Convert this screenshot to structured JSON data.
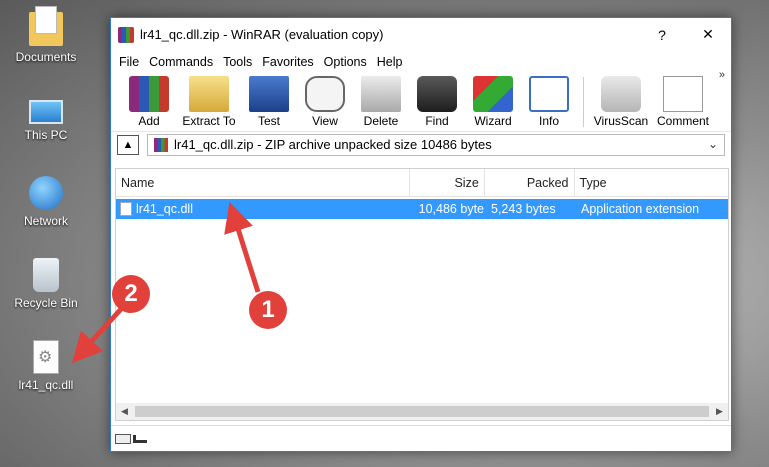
{
  "desktop": {
    "icons": [
      {
        "label": "Documents"
      },
      {
        "label": "This PC"
      },
      {
        "label": "Network"
      },
      {
        "label": "Recycle Bin"
      },
      {
        "label": "lr41_qc.dll"
      }
    ]
  },
  "window": {
    "title": "lr41_qc.dll.zip - WinRAR (evaluation copy)",
    "help_btn": "?",
    "close_btn": "✕",
    "menu": [
      "File",
      "Commands",
      "Tools",
      "Favorites",
      "Options",
      "Help"
    ],
    "toolbar": [
      "Add",
      "Extract To",
      "Test",
      "View",
      "Delete",
      "Find",
      "Wizard",
      "Info",
      "VirusScan",
      "Comment"
    ],
    "toolbar_more": "»",
    "address": "lr41_qc.dll.zip - ZIP archive unpacked size 10486 bytes",
    "columns": {
      "name": "Name",
      "size": "Size",
      "packed": "Packed",
      "type": "Type"
    },
    "files": [
      {
        "name": "lr41_qc.dll",
        "size": "10,486 byte",
        "packed": "5,243 bytes",
        "type": "Application extension"
      }
    ]
  },
  "annotations": {
    "step1": "1",
    "step2": "2",
    "color": "#e2403b"
  }
}
